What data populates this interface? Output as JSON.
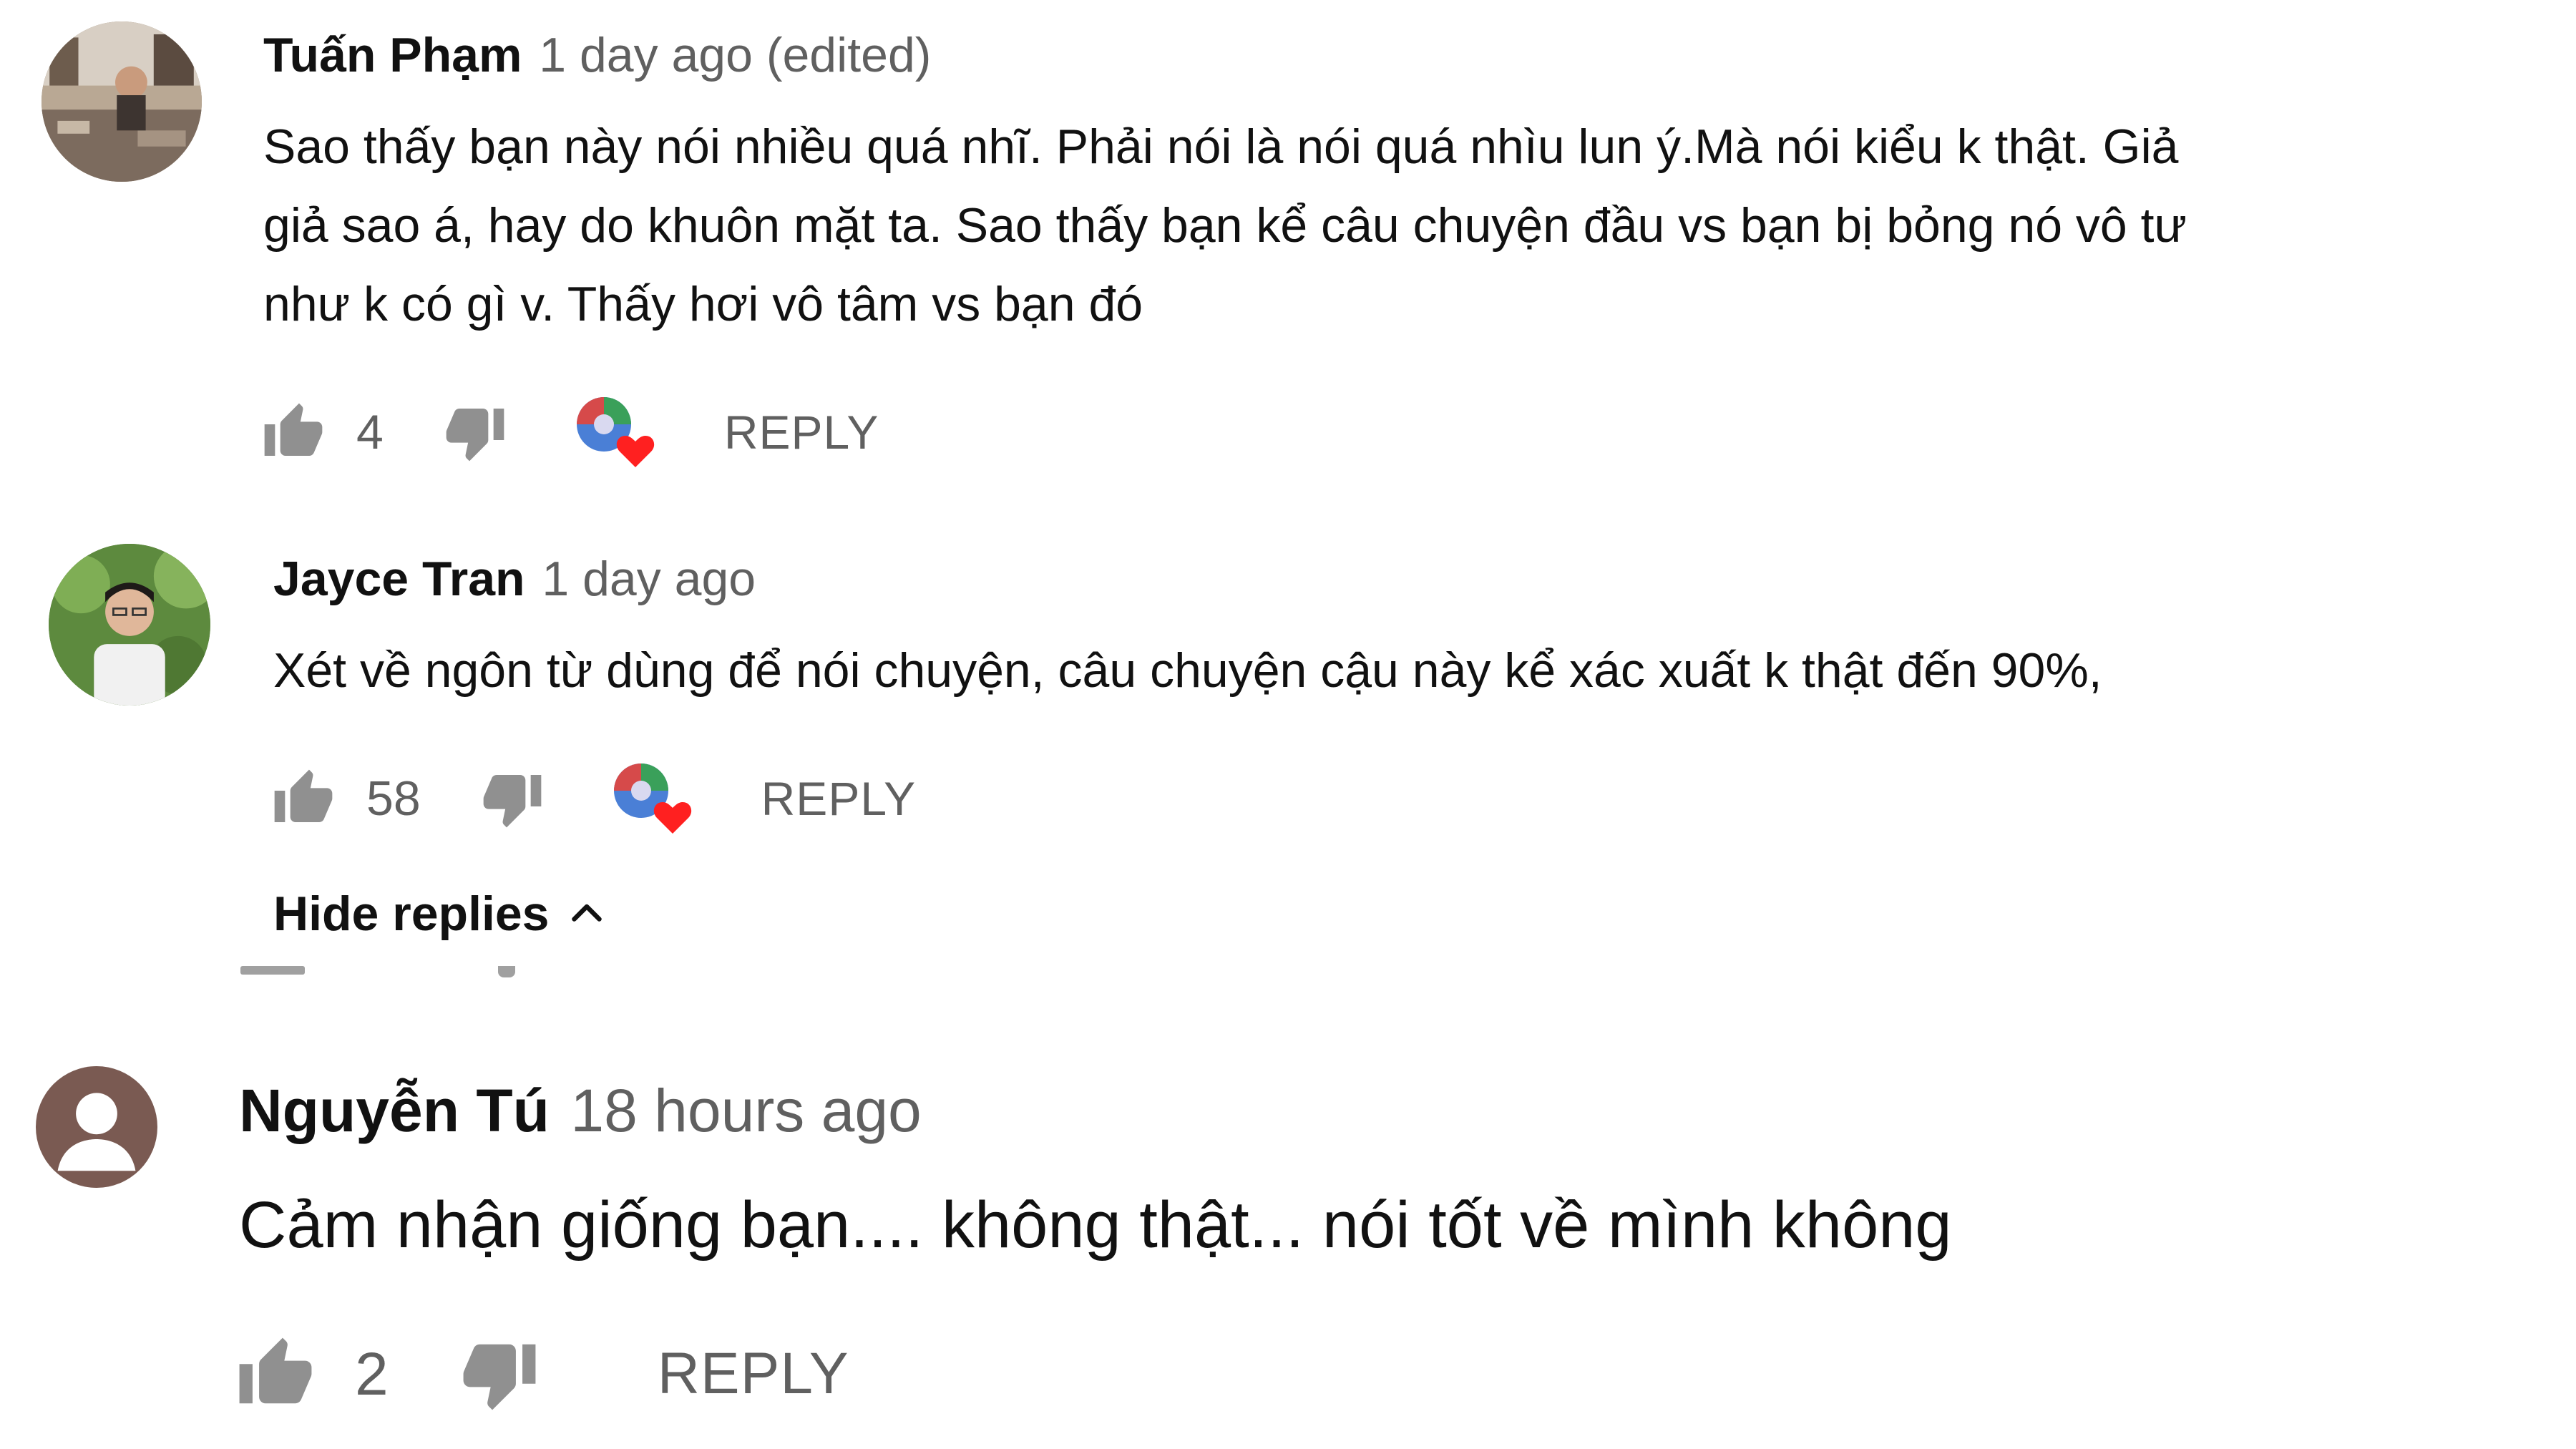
{
  "comments": [
    {
      "author": "Tuấn Phạm",
      "time": "1 day ago (edited)",
      "lines": [
        "Sao thấy bạn này nói nhiều quá nhĩ. Phải nói là nói quá nhìu lun ý.Mà nói kiểu k thật. Giả",
        "giả sao á, hay do khuôn mặt ta. Sao thấy bạn kể câu chuyện đầu vs bạn bị bỏng nó vô tư",
        "như k có gì v. Thấy hơi vô tâm vs bạn đó"
      ],
      "likes": "4",
      "reply_label": "REPLY",
      "creator_heart": true
    },
    {
      "author": "Jayce Tran",
      "time": "1 day ago",
      "lines": [
        "Xét về ngôn từ dùng để nói chuyện, câu chuyện cậu này kể xác xuất k thật đến 90%,"
      ],
      "likes": "58",
      "reply_label": "REPLY",
      "creator_heart": true,
      "hide_replies_label": "Hide replies"
    },
    {
      "author": "Nguyễn Tú",
      "time": "18 hours ago",
      "lines": [
        "Cảm nhận giống bạn.... không thật... nói tốt về mình không"
      ],
      "likes": "2",
      "reply_label": "REPLY",
      "creator_heart": false
    }
  ],
  "icons": {
    "like": "thumbs-up-icon",
    "dislike": "thumbs-down-icon",
    "heart": "creator-heart-icon",
    "chevron": "chevron-up-icon"
  },
  "colors": {
    "text": "#111111",
    "meta": "#606060",
    "icon": "#909090",
    "heart": "#ff0000",
    "default_avatar_bg": "#7a5a52"
  }
}
